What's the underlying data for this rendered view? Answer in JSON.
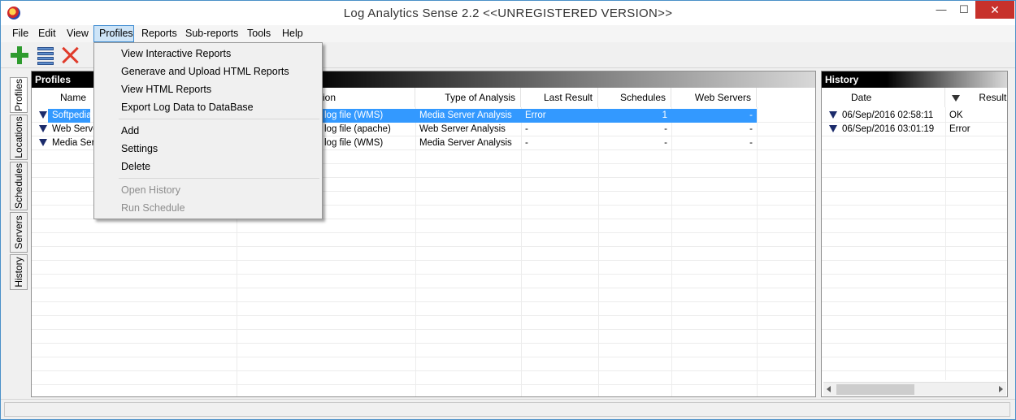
{
  "window": {
    "title": "Log Analytics Sense 2.2 <<UNREGISTERED VERSION>>",
    "min_glyph": "—",
    "max_glyph": "☐",
    "close_glyph": "✕"
  },
  "menubar": {
    "items": [
      "File",
      "Edit",
      "View",
      "Profiles",
      "Reports",
      "Sub-reports",
      "Tools",
      "Help"
    ],
    "active": "Profiles"
  },
  "profiles_menu": {
    "items": [
      {
        "label": "View Interactive Reports",
        "enabled": true
      },
      {
        "label": "Generave and Upload HTML Reports",
        "enabled": true
      },
      {
        "label": "View HTML Reports",
        "enabled": true
      },
      {
        "label": "Export Log Data to DataBase",
        "enabled": true
      },
      {
        "label": "Add",
        "enabled": true
      },
      {
        "label": "Settings",
        "enabled": true
      },
      {
        "label": "Delete",
        "enabled": true
      },
      {
        "label": "Open History",
        "enabled": false
      },
      {
        "label": "Run Schedule",
        "enabled": false
      }
    ]
  },
  "sidetabs": [
    "Profiles",
    "Locations",
    "Schedules",
    "Servers",
    "History"
  ],
  "profiles_panel": {
    "header": "Profiles",
    "columns": [
      "Name",
      "ion",
      "Type of Analysis",
      "Last Result",
      "Schedules",
      "Web Servers"
    ],
    "rows": [
      {
        "name": "Softpedia",
        "location": "log file (WMS)",
        "type": "Media Server Analysis",
        "last_result": "Error",
        "schedules": "1",
        "web_servers": "-"
      },
      {
        "name": "Web Server",
        "location": "log file (apache)",
        "type": "Web Server Analysis",
        "last_result": "-",
        "schedules": "-",
        "web_servers": "-"
      },
      {
        "name": "Media Serv",
        "location": "log file (WMS)",
        "type": "Media Server Analysis",
        "last_result": "-",
        "schedules": "-",
        "web_servers": "-"
      }
    ]
  },
  "history_panel": {
    "header": "History",
    "columns": [
      "Date",
      "Result"
    ],
    "rows": [
      {
        "date": "06/Sep/2016 02:58:11",
        "result": "OK"
      },
      {
        "date": "06/Sep/2016 03:01:19",
        "result": "Error"
      }
    ]
  },
  "colors": {
    "selection": "#3399ff",
    "close_button": "#c7312b",
    "menu_highlight": "#cde4f7"
  }
}
